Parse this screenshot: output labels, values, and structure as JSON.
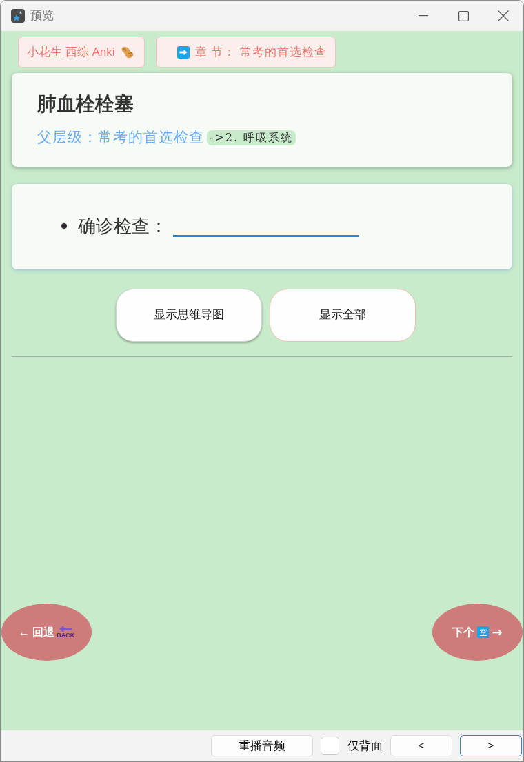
{
  "window": {
    "title": "预览"
  },
  "tags": [
    {
      "kind": "deck",
      "text": "小花生 西综 Anki"
    },
    {
      "kind": "chapter",
      "text": "章 节： 常考的首选检查"
    }
  ],
  "card": {
    "title": "肺血栓栓塞",
    "parent_label": "父层级：常考的首选检查",
    "parent_badge": "->2. 呼吸系统"
  },
  "cloze": {
    "items": [
      {
        "label": "确诊检查："
      }
    ]
  },
  "buttons": [
    {
      "label": "显示思维导图",
      "kind": "plain"
    },
    {
      "label": "显示全部",
      "kind": "outlined"
    }
  ],
  "nav": {
    "back": {
      "arrow": "←",
      "label": "回退",
      "badge": "BACK"
    },
    "next": {
      "label": "下个",
      "badge": "空",
      "arrow": "→"
    }
  },
  "bottom_bar": {
    "replay": "重播音频",
    "back_only": {
      "label": "仅背面",
      "checked": false
    },
    "prev": {
      "label": "<",
      "focused": false
    },
    "next": {
      "label": ">",
      "focused": true
    }
  }
}
